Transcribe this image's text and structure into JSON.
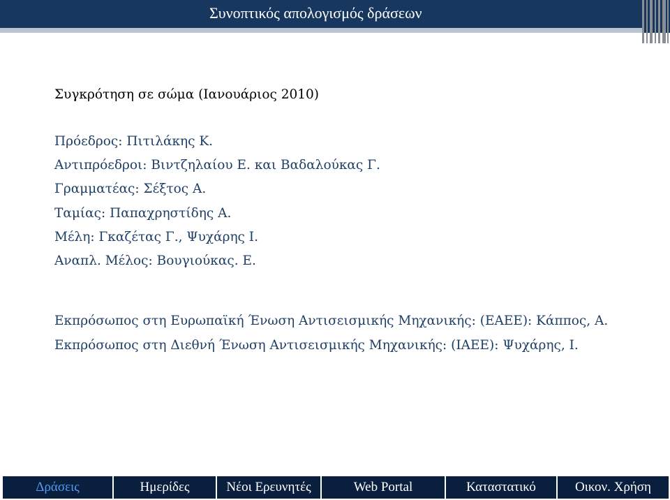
{
  "header": {
    "title": "Συνοπτικός απολογισμός δράσεων"
  },
  "content": {
    "section_title": "Συγκρότηση σε σώμα (Ιανουάριος 2010)",
    "members": [
      "Πρόεδρος: Πιτιλάκης Κ.",
      "Αντιπρόεδροι: Βιντζηλαίου Ε. και Βαδαλούκας Γ.",
      "Γραμματέας: Σέξτος Α.",
      "Ταμίας: Παπαχρηστίδης Α.",
      "Μέλη: Γκαζέτας Γ., Ψυχάρης Ι.",
      "Αναπλ. Μέλος: Βουγιούκας. Ε."
    ],
    "representatives": [
      "Εκπρόσωπος  στη Ευρωπαϊκή Ένωση Αντισεισμικής Μηχανικής: (ΕΑΕΕ): Κάππος, Α.",
      "Εκπρόσωπος  στη Διεθνή Ένωση Αντισεισμικής Μηχανικής: (ΙΑΕΕ): Ψυχάρης, Ι."
    ]
  },
  "nav": {
    "items": [
      {
        "label": "Δράσεις",
        "active": true
      },
      {
        "label": "Ημερίδες",
        "active": false
      },
      {
        "label": "Νέοι Ερευνητές",
        "active": false
      },
      {
        "label": "Web Portal",
        "active": false
      },
      {
        "label": "Καταστατικό",
        "active": false
      },
      {
        "label": "Οικον. Χρήση",
        "active": false
      }
    ]
  },
  "colors": {
    "header_bg": "#17375e",
    "nav_bg": "#0a1f3d",
    "nav_active_text": "#4f9df0",
    "body_text": "#1f3f66"
  }
}
